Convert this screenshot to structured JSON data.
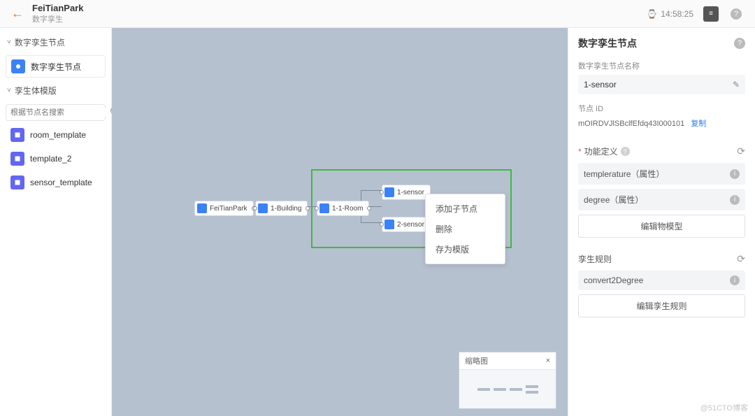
{
  "header": {
    "title": "FeiTianPark",
    "subtitle": "数字孪生",
    "time": "14:58:25"
  },
  "left": {
    "section1": {
      "title": "数字孪生节点",
      "item": "数字孪生节点"
    },
    "section2": {
      "title": "孪生体模版",
      "search_placeholder": "根据节点名搜索",
      "templates": [
        "room_template",
        "template_2",
        "sensor_template"
      ]
    }
  },
  "canvas": {
    "nodes": {
      "n1": "FeiTianPark",
      "n2": "1-Building",
      "n3": "1-1-Room",
      "n4": "1-sensor",
      "n5": "2-sensor"
    },
    "context_menu": [
      "添加子节点",
      "删除",
      "存为模版"
    ],
    "minimap": {
      "title": "缩略图",
      "close": "×"
    }
  },
  "right": {
    "panel_title": "数字孪生节点",
    "name_label": "数字孪生节点名称",
    "name_value": "1-sensor",
    "id_label": "节点 ID",
    "id_value": "mOIRDVJlSBclfEfdq43I000101",
    "copy_label": "复制",
    "func_def_label": "功能定义",
    "props": [
      {
        "text": "templerature（属性）"
      },
      {
        "text": "degree（属性）"
      }
    ],
    "edit_model_btn": "编辑物模型",
    "rules_label": "孪生规则",
    "rules": [
      {
        "text": "convert2Degree"
      }
    ],
    "edit_rules_btn": "编辑孪生规则"
  },
  "watermark": "@51CTO博客"
}
